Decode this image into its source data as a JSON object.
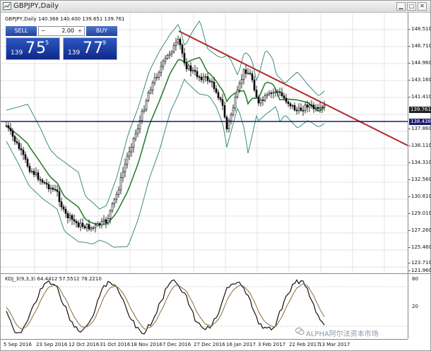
{
  "window": {
    "title": "GBPJPY,Daily"
  },
  "symbol_line": "GBPJPY,Daily  140.368 140.400 139.651 139.761",
  "trade_panel": {
    "sell_label": "SELL",
    "buy_label": "BUY",
    "lot_value": "2.00",
    "sell_prefix": "139",
    "sell_big": "75",
    "sell_sup": "5",
    "buy_prefix": "139",
    "buy_big": "77",
    "buy_sup": "9"
  },
  "price_axis": {
    "labels": [
      "148.510",
      "146.710",
      "144.960",
      "143.160",
      "141.410",
      "139.761",
      "138.438",
      "137.860",
      "136.110",
      "134.310",
      "132.560",
      "130.810",
      "129.010",
      "127.260",
      "125.460",
      "123.710",
      "121.960"
    ],
    "current_price_tag": "139.761",
    "line_price_tag": "138.438"
  },
  "time_axis": {
    "labels": [
      "5 Sep 2016",
      "23 Sep 2016",
      "12 Oct 2016",
      "31 Oct 2016",
      "18 Nov 2016",
      "7 Dec 2016",
      "27 Dec 2016",
      "16 Jan 2017",
      "3 Feb 2017",
      "22 Feb 2017",
      "13 Mar 2017"
    ]
  },
  "indicator": {
    "title": "KDJ_3(9,3,3) 64.4412 57.5512 78.2210",
    "levels": [
      "80",
      "20"
    ]
  },
  "watermark": "ALPHA阿尔法资本市场",
  "colors": {
    "trendline": "#b22a2a",
    "support": "#1a1a6e",
    "ma": "#2e7d32",
    "bands": "#3c8d7e",
    "tag_bg": "#1a1a6e"
  }
}
